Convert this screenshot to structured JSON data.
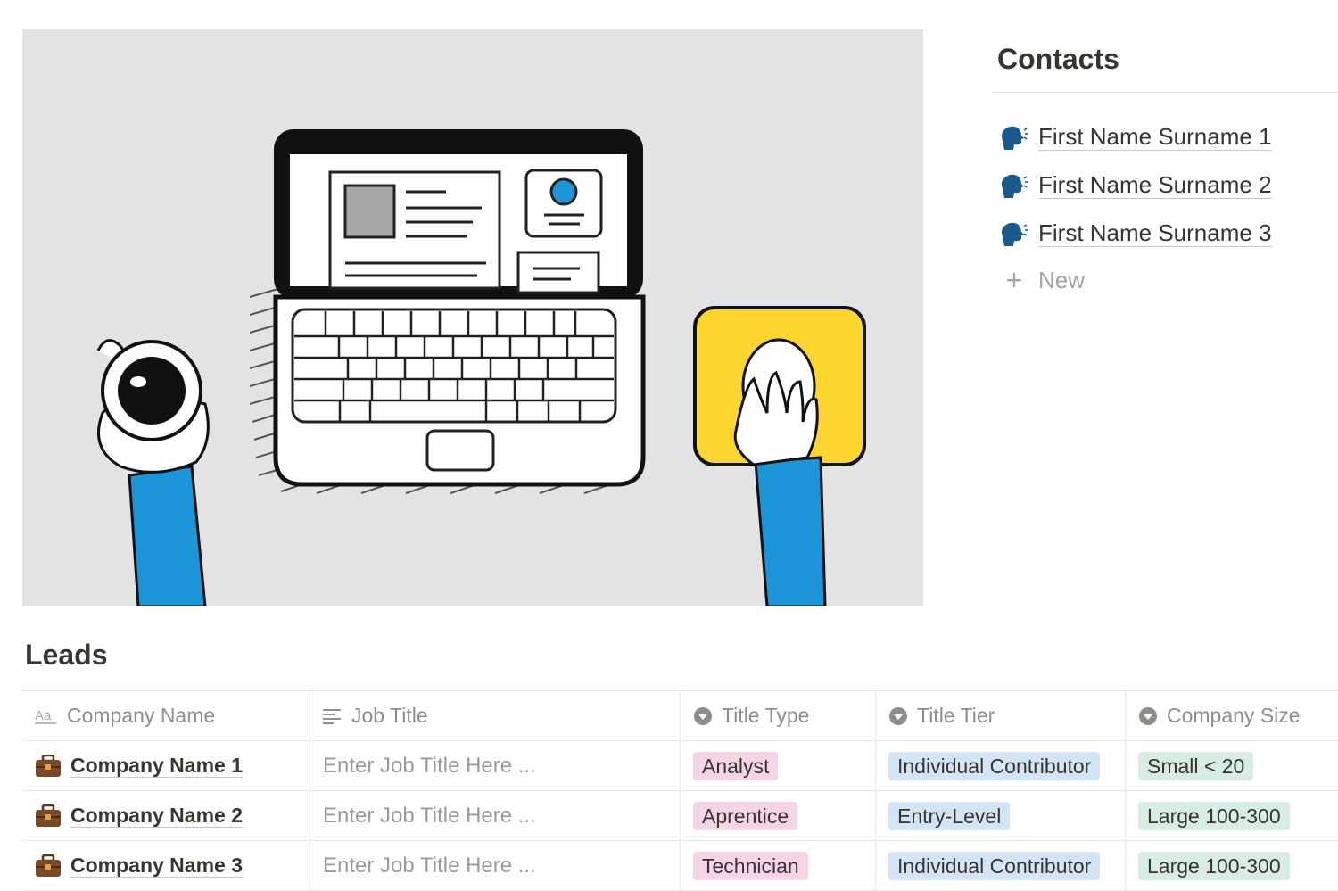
{
  "contacts": {
    "title": "Contacts",
    "items": [
      {
        "label": "First Name Surname 1",
        "icon": "speaking-head-icon"
      },
      {
        "label": "First Name Surname 2",
        "icon": "speaking-head-icon"
      },
      {
        "label": "First Name Surname 3",
        "icon": "speaking-head-icon"
      }
    ],
    "new_label": "New"
  },
  "leads": {
    "title": "Leads",
    "columns": [
      {
        "label": "Company Name",
        "icon": "title-property-icon"
      },
      {
        "label": "Job Title",
        "icon": "text-property-icon"
      },
      {
        "label": "Title Type",
        "icon": "select-property-icon"
      },
      {
        "label": "Title Tier",
        "icon": "select-property-icon"
      },
      {
        "label": "Company Size",
        "icon": "select-property-icon"
      }
    ],
    "rows": [
      {
        "company": "Company Name 1",
        "job_title_placeholder": "Enter Job Title Here ...",
        "title_type": "Analyst",
        "title_tier": "Individual Contributor",
        "company_size": "Small < 20"
      },
      {
        "company": "Company Name 2",
        "job_title_placeholder": "Enter Job Title Here ...",
        "title_type": "Aprentice",
        "title_tier": "Entry-Level",
        "company_size": "Large 100-300"
      },
      {
        "company": "Company Name 3",
        "job_title_placeholder": "Enter Job Title Here ...",
        "title_type": "Technician",
        "title_tier": "Individual Contributor",
        "company_size": "Large 100-300"
      }
    ]
  },
  "colors": {
    "hero_background": "#e3e3e3",
    "tag_pink": "#f5d5e5",
    "tag_blue": "#d3e5f5",
    "tag_green": "#d7ece3",
    "accent_blue": "#1c95d8",
    "accent_yellow": "#fdd530"
  },
  "hero": {
    "description_icon": "laptop-desk-illustration"
  }
}
